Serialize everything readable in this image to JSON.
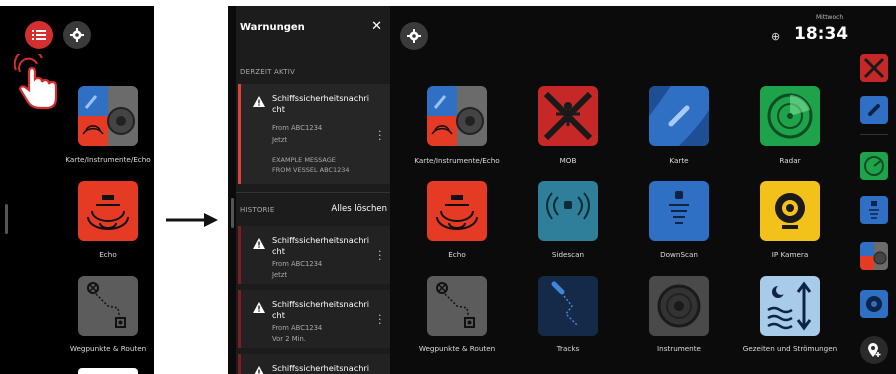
{
  "left": {
    "tiles": [
      {
        "label": "Karte/Instrumente/Echo",
        "icon": "chart-instruments-echo-icon"
      },
      {
        "label": "Echo",
        "icon": "echo-icon"
      },
      {
        "label": "Wegpunkte & Routen",
        "icon": "waypoints-routes-icon"
      }
    ]
  },
  "warnings": {
    "title": "Warnungen",
    "close_glyph": "✕",
    "active_section": "DERZEIT AKTIV",
    "history_section": "HISTORIE",
    "clear_all": "Alles löschen",
    "active": [
      {
        "title": "Schiffssicherheitsnachricht",
        "from": "From ABC1234",
        "time": "Jetzt",
        "message_1": "EXAMPLE MESSAGE",
        "message_2": "FROM VESSEL ABC1234"
      }
    ],
    "history": [
      {
        "title": "Schiffssicherheitsnachricht",
        "from": "From ABC1234",
        "time": "Jetzt"
      },
      {
        "title": "Schiffssicherheitsnachricht",
        "from": "From ABC1234",
        "time": "Vor 2 Min."
      },
      {
        "title": "Schiffssicherheitsnachricht"
      }
    ]
  },
  "clock": {
    "day": "Mittwoch",
    "time": "18:34"
  },
  "apps": [
    {
      "label": "Karte/Instrumente/Echo",
      "icon": "chart-instruments-echo-icon"
    },
    {
      "label": "MOB",
      "icon": "mob-icon"
    },
    {
      "label": "Karte",
      "icon": "chart-icon"
    },
    {
      "label": "Radar",
      "icon": "radar-icon"
    },
    {
      "label": "Echo",
      "icon": "echo-icon"
    },
    {
      "label": "Sidescan",
      "icon": "sidescan-icon"
    },
    {
      "label": "DownScan",
      "icon": "downscan-icon"
    },
    {
      "label": "IP Kamera",
      "icon": "ip-camera-icon"
    },
    {
      "label": "Wegpunkte & Routen",
      "icon": "waypoints-routes-icon"
    },
    {
      "label": "Tracks",
      "icon": "tracks-icon"
    },
    {
      "label": "Instrumente",
      "icon": "instruments-icon"
    },
    {
      "label": "Gezeiten und Strömungen",
      "icon": "tides-currents-icon"
    }
  ],
  "colors": {
    "alert_red": "#e0413a",
    "echo_red": "#e53a24",
    "chart_blue": "#2f6fc4",
    "radar_green": "#1ea34a",
    "camera_yellow": "#f2c21b",
    "sidescan_teal": "#2f7f9a"
  }
}
